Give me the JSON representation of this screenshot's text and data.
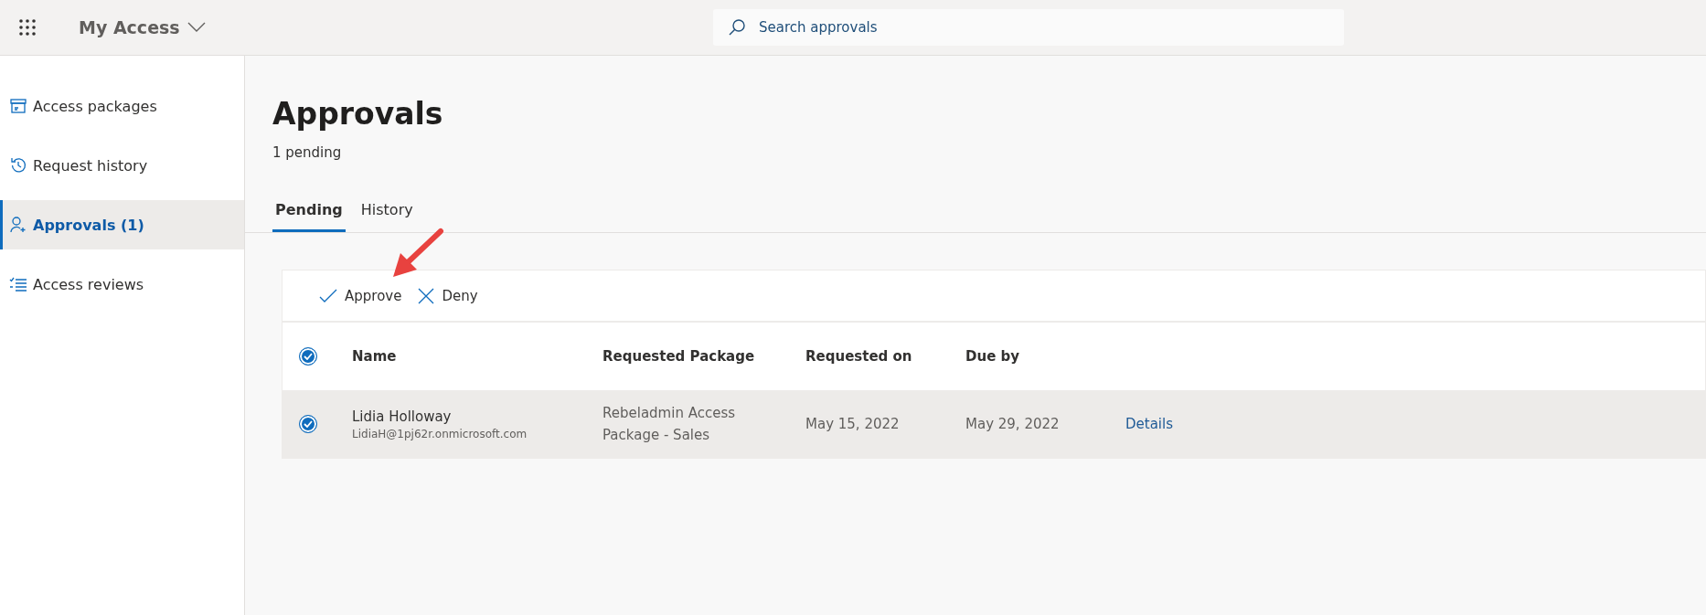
{
  "header": {
    "app_title": "My Access",
    "search": {
      "placeholder": "Search approvals"
    }
  },
  "sidebar": {
    "items": [
      {
        "label": "Access packages",
        "kind": "package",
        "selected": false
      },
      {
        "label": "Request history",
        "kind": "history",
        "selected": false
      },
      {
        "label": "Approvals (1)",
        "kind": "approvals",
        "selected": true
      },
      {
        "label": "Access reviews",
        "kind": "reviews",
        "selected": false
      }
    ]
  },
  "page": {
    "title": "Approvals",
    "subtitle": "1 pending"
  },
  "tabs": [
    {
      "label": "Pending",
      "selected": true
    },
    {
      "label": "History",
      "selected": false
    }
  ],
  "toolbar": [
    {
      "label": "Approve",
      "kind": "approve"
    },
    {
      "label": "Deny",
      "kind": "deny"
    }
  ],
  "table": {
    "select_all_checked": true,
    "columns": [
      "Name",
      "Requested Package",
      "Requested on",
      "Due by"
    ],
    "rows": [
      {
        "name": "Lidia Holloway",
        "email": "LidiaH@1pj62r.onmicrosoft.com",
        "package": "Rebeladmin Access Package - Sales",
        "requested_on": "May 15, 2022",
        "due_by": "May 29, 2022",
        "link": "Details",
        "selected": true
      }
    ]
  }
}
